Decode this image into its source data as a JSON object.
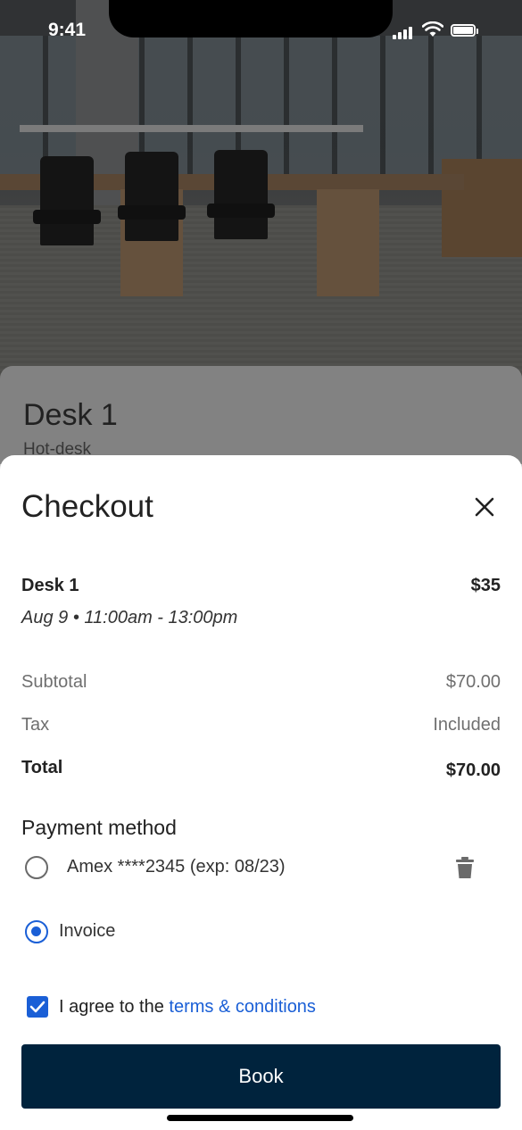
{
  "status_bar": {
    "time": "9:41"
  },
  "background_listing": {
    "title": "Desk 1",
    "subtitle": "Hot-desk"
  },
  "checkout": {
    "title": "Checkout",
    "item": {
      "name": "Desk 1",
      "price": "$35",
      "datetime": "Aug 9 • 11:00am - 13:00pm"
    },
    "summary": [
      {
        "label": "Subtotal",
        "value": "$70.00"
      },
      {
        "label": "Tax",
        "value": "Included"
      },
      {
        "label": "Total",
        "value": "$70.00"
      }
    ],
    "payment": {
      "title": "Payment method",
      "options": [
        {
          "label": "Amex ****2345 (exp: 08/23)",
          "selected": false
        },
        {
          "label": "Invoice",
          "selected": true
        }
      ]
    },
    "agreement": {
      "prefix": "I agree to the ",
      "link_text": "terms & conditions",
      "checked": true
    },
    "book_label": "Book"
  },
  "colors": {
    "accent": "#1a5fd6",
    "button_bg": "#00233d"
  }
}
